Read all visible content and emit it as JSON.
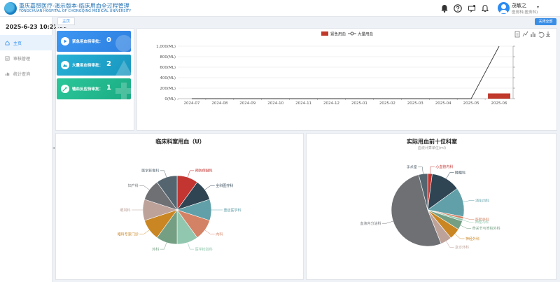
{
  "header": {
    "title_cn": "重庆嘉赟医疗-演示版本-临床用血全过程管理",
    "title_en": "YONGCHUAN HOSPITAL OF CHONGQING MEDICAL UNIVERSITY",
    "user_name": "茂敏之",
    "user_dept": "医务科(医务科)",
    "icons": [
      "bell-icon",
      "help-icon",
      "message-icon",
      "notification-icon"
    ]
  },
  "sidebar": {
    "clock": "2025-6-23 10:21:22",
    "items": [
      {
        "label": "主页",
        "icon": "home-icon",
        "active": true
      },
      {
        "label": "审核管理",
        "icon": "audit-icon",
        "active": false
      },
      {
        "label": "统计查询",
        "icon": "stats-icon",
        "active": false
      }
    ]
  },
  "tabs": {
    "home": "主页",
    "close_all": "关闭全部"
  },
  "cards": [
    {
      "label": "紧急用血待审批：",
      "count": "0",
      "color": "#2d8cf0",
      "icon": "play-icon"
    },
    {
      "label": "大量用血待审批：",
      "count": "2",
      "color": "#1aa6c9",
      "icon": "mountain-icon"
    },
    {
      "label": "输血反应待审批：",
      "count": "1",
      "color": "#1fbf8f",
      "icon": "syringe-icon"
    }
  ],
  "chart_data": [
    {
      "type": "bar",
      "legend": [
        "紧急用血",
        "大量用血"
      ],
      "legend_placement": "top-center",
      "categories": [
        "2024-07",
        "2024-08",
        "2024-09",
        "2024-10",
        "2024-11",
        "2024-12",
        "2025-01",
        "2025-02",
        "2025-03",
        "2025-04",
        "2025-05",
        "2025-06"
      ],
      "series": [
        {
          "name": "紧急用血",
          "type": "bar",
          "values": [
            0,
            0,
            0,
            0,
            0,
            0,
            0,
            0,
            0,
            0,
            0,
            100
          ],
          "color": "#c0392b"
        },
        {
          "name": "大量用血",
          "type": "line",
          "values": [
            0,
            0,
            0,
            0,
            0,
            0,
            0,
            0,
            0,
            0,
            0,
            1000
          ],
          "color": "#333333"
        }
      ],
      "yticks": [
        "0(ML)",
        "200(ML)",
        "400(ML)",
        "600(ML)",
        "800(ML)",
        "1,000(ML)"
      ],
      "ylim": [
        0,
        1000
      ],
      "toolbox": [
        "data-view-icon",
        "line-chart-icon",
        "bar-chart-icon",
        "restore-icon",
        "download-icon"
      ]
    },
    {
      "type": "pie",
      "title": "临床科室用血（U）",
      "slices": [
        {
          "label": "预防保健科",
          "value": 10,
          "color": "#c23531"
        },
        {
          "label": "全科医疗科",
          "value": 10,
          "color": "#2f4554"
        },
        {
          "label": "重症医学科",
          "value": 10,
          "color": "#61a0a8"
        },
        {
          "label": "内科",
          "value": 10,
          "color": "#d48265"
        },
        {
          "label": "医学检验科",
          "value": 10,
          "color": "#91c7ae"
        },
        {
          "label": "外科",
          "value": 10,
          "color": "#749f83"
        },
        {
          "label": "眼科专家门诊",
          "value": 10,
          "color": "#ca8622"
        },
        {
          "label": "眼耳科",
          "value": 10,
          "color": "#bda29a"
        },
        {
          "label": "妇产科",
          "value": 10,
          "color": "#6e7074"
        },
        {
          "label": "医学影像科",
          "value": 10,
          "color": "#546570"
        }
      ]
    },
    {
      "type": "pie",
      "title": "实际用血前十位科室",
      "subtitle": "血液计算单位(ml)",
      "slices": [
        {
          "label": "心血管内科",
          "value": 2,
          "color": "#c23531"
        },
        {
          "label": "肿瘤科",
          "value": 13,
          "color": "#2f4554"
        },
        {
          "label": "消化内科",
          "value": 13,
          "color": "#61a0a8"
        },
        {
          "label": "肝胆外科",
          "value": 1,
          "color": "#d48265"
        },
        {
          "label": "神经内科",
          "value": 1,
          "color": "#91c7ae"
        },
        {
          "label": "骨关节与脊柱外科",
          "value": 4,
          "color": "#749f83"
        },
        {
          "label": "神经外科",
          "value": 5,
          "color": "#ca8622"
        },
        {
          "label": "急诊外科",
          "value": 5,
          "color": "#bda29a"
        },
        {
          "label": "血液内分泌科",
          "value": 52,
          "color": "#6e7074"
        },
        {
          "label": "手术室",
          "value": 4,
          "color": "#546570"
        }
      ]
    }
  ]
}
